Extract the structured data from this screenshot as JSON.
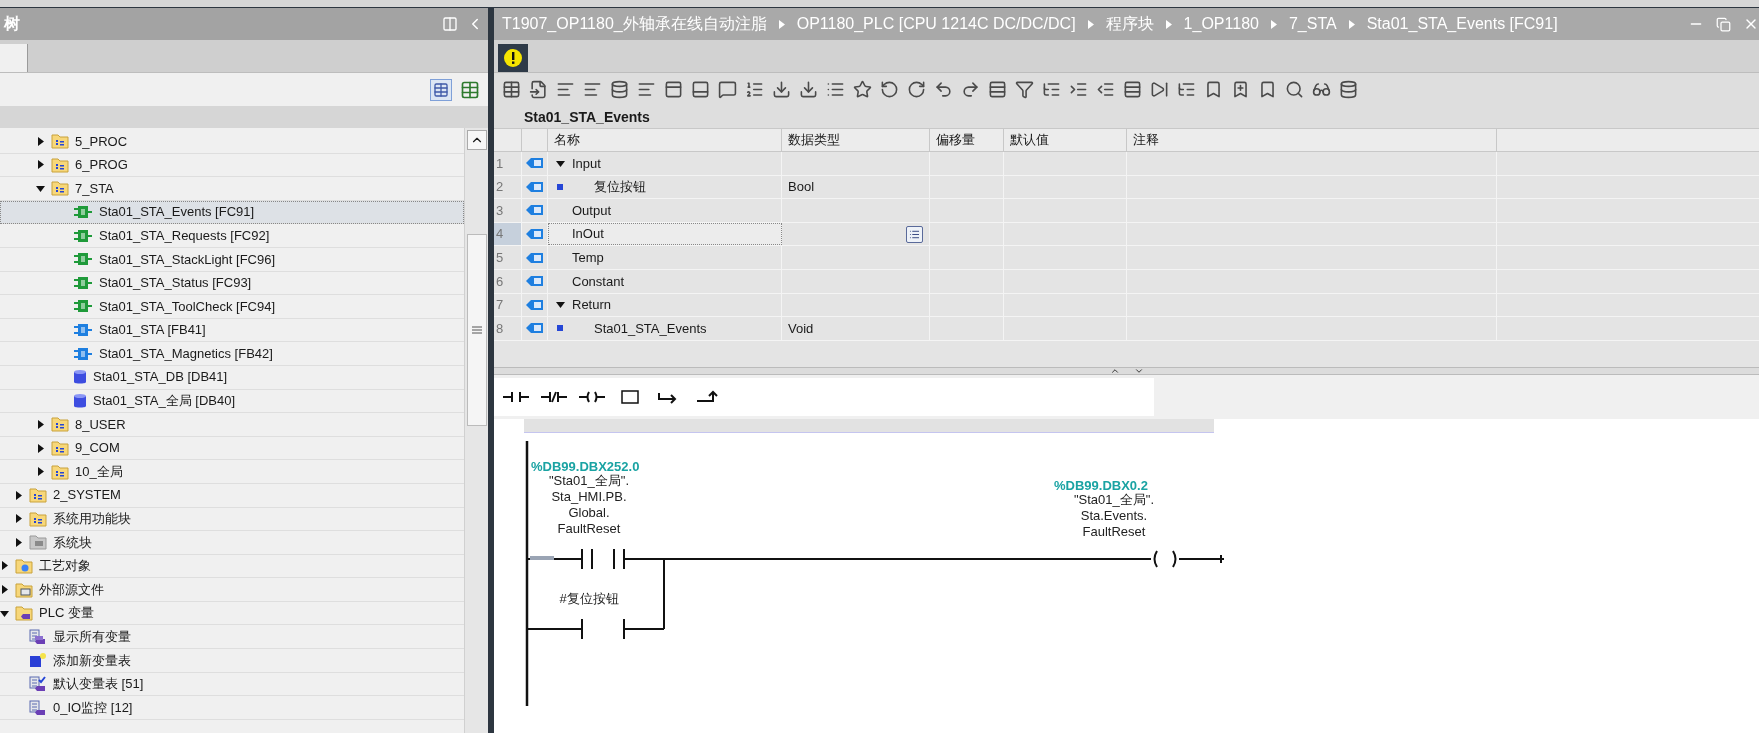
{
  "project_tree": {
    "title": "树",
    "items": [
      {
        "children": [
          {
            "children": [
              {
                "label": "5_PROC",
                "kind": "folder",
                "expanded": false,
                "selected": false
              },
              {
                "label": "6_PROG",
                "kind": "folder",
                "expanded": false,
                "selected": false
              },
              {
                "label": "7_STA",
                "kind": "folder",
                "expanded": true,
                "selected": false,
                "children": [
                  {
                    "label": "Sta01_STA_Events [FC91]",
                    "kind": "fc",
                    "selected": true
                  },
                  {
                    "label": "Sta01_STA_Requests [FC92]",
                    "kind": "fc",
                    "selected": false
                  },
                  {
                    "label": "Sta01_STA_StackLight [FC96]",
                    "kind": "fc",
                    "selected": false
                  },
                  {
                    "label": "Sta01_STA_Status [FC93]",
                    "kind": "fc",
                    "selected": false
                  },
                  {
                    "label": "Sta01_STA_ToolCheck [FC94]",
                    "kind": "fc",
                    "selected": false
                  },
                  {
                    "label": "Sta01_STA [FB41]",
                    "kind": "fb",
                    "selected": false
                  },
                  {
                    "label": "Sta01_STA_Magnetics [FB42]",
                    "kind": "fb",
                    "selected": false
                  },
                  {
                    "label": "Sta01_STA_DB [DB41]",
                    "kind": "db",
                    "selected": false
                  },
                  {
                    "label": "Sta01_STA_全局 [DB40]",
                    "kind": "db",
                    "selected": false
                  }
                ]
              },
              {
                "label": "8_USER",
                "kind": "folder",
                "expanded": false,
                "selected": false
              },
              {
                "label": "9_COM",
                "kind": "folder",
                "expanded": false,
                "selected": false
              },
              {
                "label": "10_全局",
                "kind": "folder",
                "expanded": false,
                "selected": false
              }
            ]
          },
          {
            "label": "2_SYSTEM",
            "kind": "folder",
            "expanded": false,
            "selected": false
          },
          {
            "label": "系统用功能块",
            "kind": "folder",
            "expanded": false,
            "selected": false
          },
          {
            "label": "系统块",
            "kind": "sysfolder",
            "expanded": false,
            "selected": false
          }
        ]
      },
      {
        "label": "工艺对象",
        "kind": "techfolder",
        "expanded": false,
        "selected": false
      },
      {
        "label": "外部源文件",
        "kind": "extfolder",
        "expanded": false,
        "selected": false
      },
      {
        "label": "PLC 变量",
        "kind": "tagfolder",
        "expanded": true,
        "selected": false,
        "children": [
          {
            "label": "显示所有变量",
            "kind": "alltags",
            "selected": false
          },
          {
            "label": "添加新变量表",
            "kind": "addtable",
            "selected": false
          },
          {
            "label": "默认变量表 [51]",
            "kind": "defaulttable",
            "selected": false
          },
          {
            "label": "0_IO监控 [12]",
            "kind": "table",
            "selected": false
          }
        ]
      }
    ]
  },
  "editor": {
    "breadcrumb": [
      "T1907_OP1180_外轴承在线自动注脂",
      "OP1180_PLC [CPU 1214C DC/DC/DC]",
      "程序块",
      "1_OP1180",
      "7_STA",
      "Sta01_STA_Events [FC91]"
    ],
    "block_title": "Sta01_STA_Events",
    "interface": {
      "columns": [
        "名称",
        "数据类型",
        "偏移量",
        "默认值",
        "注释"
      ],
      "rows": [
        {
          "number": "1",
          "name": "Input",
          "expanded": true,
          "selected": false,
          "children": [
            {
              "number": "2",
              "name": "复位按钮",
              "type": "Bool",
              "selected": false
            }
          ]
        },
        {
          "number": "3",
          "name": "Output",
          "selected": false
        },
        {
          "number": "4",
          "name": "InOut",
          "selected": true
        },
        {
          "number": "5",
          "name": "Temp",
          "selected": false
        },
        {
          "number": "6",
          "name": "Constant",
          "selected": false
        },
        {
          "number": "7",
          "name": "Return",
          "expanded": true,
          "selected": false,
          "children": [
            {
              "number": "8",
              "name": "Sta01_STA_Events",
              "type": "Void",
              "selected": false
            }
          ]
        }
      ]
    },
    "ladder": {
      "contacts": [
        {
          "address": "%DB99.DBX252.0",
          "operand": [
            "\"Sta01_全局\".",
            "Sta_HMI.PB.",
            "Global.",
            "FaultReset"
          ]
        },
        {
          "operand": [
            "#复位按钮"
          ]
        }
      ],
      "coil": {
        "address": "%DB99.DBX0.2",
        "operand": [
          "\"Sta01_全局\".",
          "Sta.Events.",
          "FaultReset"
        ]
      }
    }
  }
}
